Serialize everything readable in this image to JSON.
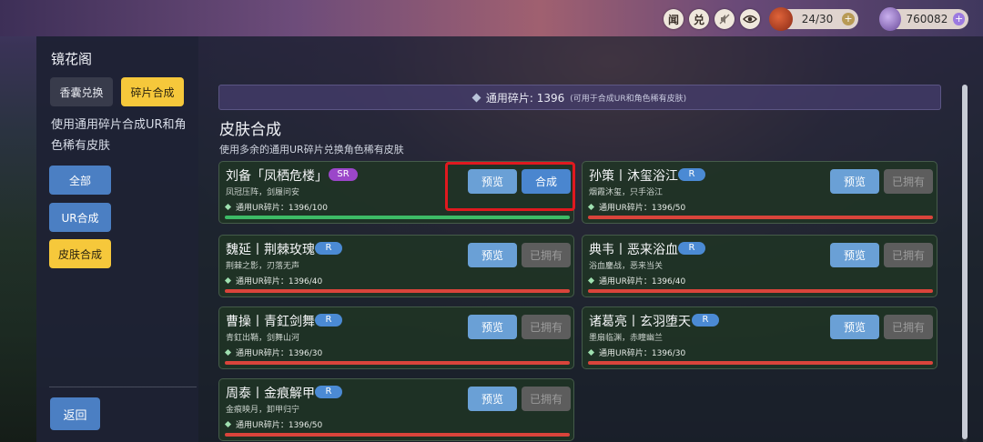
{
  "hud": {
    "icons": [
      "news-icon",
      "exchange-icon",
      "mute-icon",
      "eye-icon"
    ],
    "icon_labels": [
      "闻",
      "兑",
      "",
      ""
    ],
    "stamina": "24/30",
    "currency": "760082",
    "colors": {
      "stamina_plus": "#b89a55",
      "currency_plus": "#9c7ae0"
    }
  },
  "sidebar": {
    "title": "镜花阁",
    "tabs": [
      "香囊兑换",
      "碎片合成"
    ],
    "description": "使用通用碎片合成UR和角色稀有皮肤",
    "filters": [
      "全部",
      "UR合成",
      "皮肤合成"
    ],
    "back": "返回"
  },
  "banner": {
    "text": "通用碎片: 1396",
    "note": "(可用于合成UR和角色稀有皮肤)"
  },
  "section": {
    "title": "皮肤合成",
    "subtitle": "使用多余的通用UR碎片兑换角色稀有皮肤"
  },
  "cards": [
    {
      "name": "刘备「凤栖危楼」",
      "rarity": "SR",
      "flavor": "凤冠压阵，剑履问安",
      "progress": "通用UR碎片：1396/100",
      "left_btn": "预览",
      "right_btn": "合成"
    },
    {
      "name": "孙策丨沐玺浴江",
      "rarity": "R",
      "flavor": "烟霞沐玺，只手浴江",
      "progress": "通用UR碎片：1396/50",
      "left_btn": "预览",
      "right_btn": "已拥有"
    },
    {
      "name": "魏延丨荆棘玫瑰",
      "rarity": "R",
      "flavor": "荆棘之影，刃落无声",
      "progress": "通用UR碎片：1396/40",
      "left_btn": "预览",
      "right_btn": "已拥有"
    },
    {
      "name": "典韦丨恶来浴血",
      "rarity": "R",
      "flavor": "浴血鏖战，恶来当关",
      "progress": "通用UR碎片：1396/40",
      "left_btn": "预览",
      "right_btn": "已拥有"
    },
    {
      "name": "曹操丨青釭剑舞",
      "rarity": "R",
      "flavor": "青釭出鞘，剑舞山河",
      "progress": "通用UR碎片：1396/30",
      "left_btn": "预览",
      "right_btn": "已拥有"
    },
    {
      "name": "诸葛亮丨玄羽堕天",
      "rarity": "R",
      "flavor": "墨扇临渊，赤瞳幽兰",
      "progress": "通用UR碎片：1396/30",
      "left_btn": "预览",
      "right_btn": "已拥有"
    },
    {
      "name": "周泰丨金痕解甲",
      "rarity": "R",
      "flavor": "金痕映月，卸甲归宁",
      "progress": "通用UR碎片：1396/50",
      "left_btn": "预览",
      "right_btn": "已拥有"
    }
  ]
}
